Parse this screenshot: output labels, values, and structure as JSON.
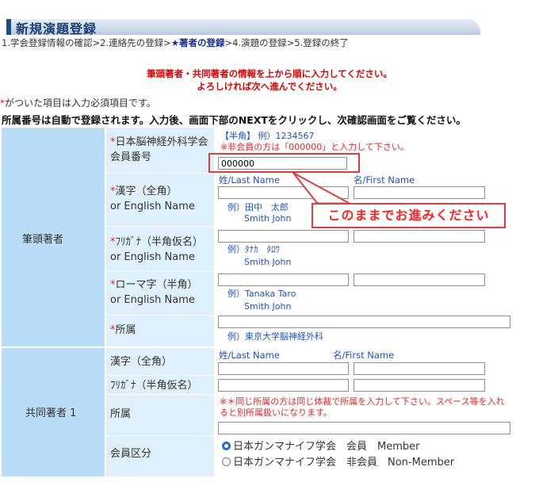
{
  "page": {
    "title": "新規演題登録",
    "steps": {
      "before": "1.学会登録情報の確認>2.連絡先の登録>",
      "current": "★著者の登録",
      "after": ">4.演題の登録>5.登録の終了"
    },
    "notice_line1": "筆頭著者・共同著者の情報を上から順に入力してください。",
    "notice_line2": "よろしければ次へ進んでください。",
    "required_star": "*",
    "required_note": "がついた項目は入力必須項目です。",
    "auto_note": "所属番号は自動で登録されます。入力後、画面下部のNEXTをクリックし、次確認画面をご覧ください。"
  },
  "first_author": {
    "section_label": "筆頭著者",
    "member_no": {
      "label_line1": "日本脳神経外科学会",
      "label_line2": "会員番号",
      "hint_line1": "【半角】 例）1234567",
      "hint_line2": "※非会員の方は「000000」と入力して下さい。",
      "value": "000000"
    },
    "col_last": "姓/Last Name",
    "col_first": "名/First Name",
    "kanji": {
      "label_line1": "漢字（全角）",
      "label_line2": "or English Name",
      "example_line1": "例）田中　太郎",
      "example_line2": "Smith John"
    },
    "kana": {
      "label_line1": "ﾌﾘｶﾞﾅ（半角仮名）",
      "label_line2": "or English Name",
      "example_line1": "例）ﾀﾅｶ　ﾀﾛｳ",
      "example_line2": "Smith John"
    },
    "roman": {
      "label_line1": "ローマ字（半角）",
      "label_line2": "or English Name",
      "example_line1": "例）Tanaka Taro",
      "example_line2": "Smith John"
    },
    "affiliation": {
      "label": "所属",
      "example": "例）東京大学脳神経外科"
    }
  },
  "co_author": {
    "section_label": "共同著者 1",
    "col_last": "姓/Last Name",
    "col_first": "名/First Name",
    "kanji_label": "漢字（全角）",
    "kana_label": "ﾌﾘｶﾞﾅ（半角仮名）",
    "affiliation_label": "所属",
    "affiliation_note_line1": "※＊同じ所属の方は同じ体裁で所属を入力して下さい。スペース等を入れ",
    "affiliation_note_line2": "ると別所属扱いになります。",
    "member_type_label": "会員区分",
    "option_member": "日本ガンマナイフ学会　会員　Member",
    "option_nonmember": "日本ガンマナイフ学会　非会員　Non-Member",
    "selected_option": "member"
  },
  "callout": {
    "text": "このままでお進みください"
  },
  "colors": {
    "left_cell": "#b9dcf7",
    "mid_cell": "#dff0fd",
    "hint_blue": "#1e50c8",
    "required_red": "#ee2222",
    "callout_red": "#e03c3c"
  }
}
